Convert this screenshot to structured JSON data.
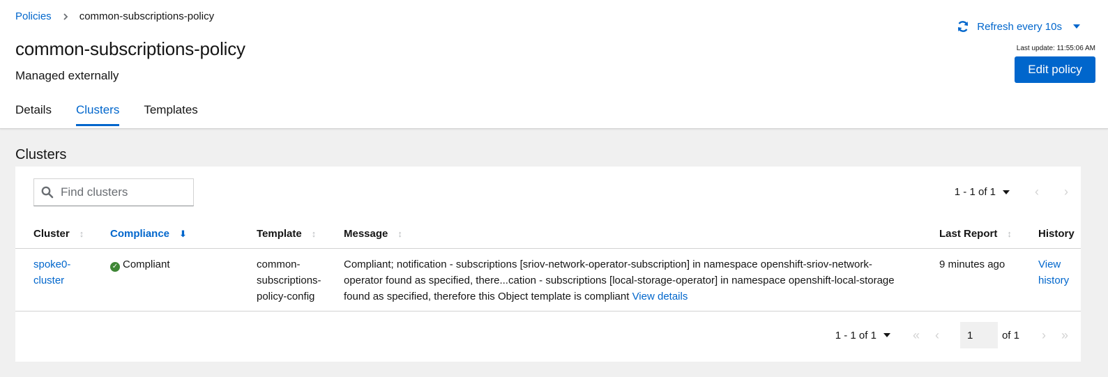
{
  "breadcrumb": {
    "parent": "Policies",
    "current": "common-subscriptions-policy"
  },
  "page": {
    "title": "common-subscriptions-policy",
    "subtitle": "Managed externally"
  },
  "refresh": {
    "label": "Refresh every 10s",
    "last_update": "Last update: 11:55:06 AM"
  },
  "edit_button": "Edit policy",
  "tabs": [
    {
      "label": "Details"
    },
    {
      "label": "Clusters",
      "active": true
    },
    {
      "label": "Templates"
    }
  ],
  "section_title": "Clusters",
  "search": {
    "placeholder": "Find clusters"
  },
  "pagination_top": {
    "range": "1 - 1 of 1"
  },
  "table": {
    "headers": {
      "cluster": "Cluster",
      "compliance": "Compliance",
      "template": "Template",
      "message": "Message",
      "last_report": "Last Report",
      "history": "History"
    },
    "rows": [
      {
        "cluster_1": "spoke0-",
        "cluster_2": "cluster",
        "compliance": "Compliant",
        "template_1": "common-",
        "template_2": "subscriptions-",
        "template_3": "policy-config",
        "message_1": "Compliant; notification - subscriptions [sriov-network-operator-subscription] in namespace openshift-sriov-network-",
        "message_2": "operator found as specified, there...cation - subscriptions [local-storage-operator] in namespace openshift-local-storage",
        "message_3": "found as specified, therefore this Object template is compliant",
        "message_link": "View details",
        "last_report": "9 minutes ago",
        "history_1": "View",
        "history_2": "history"
      }
    ]
  },
  "pagination_bottom": {
    "range": "1 - 1 of 1",
    "page": "1",
    "of_pages": "of 1"
  },
  "colors": {
    "accent": "#0066cc",
    "success": "#3e8635",
    "page_bg": "#f0f0f0"
  }
}
